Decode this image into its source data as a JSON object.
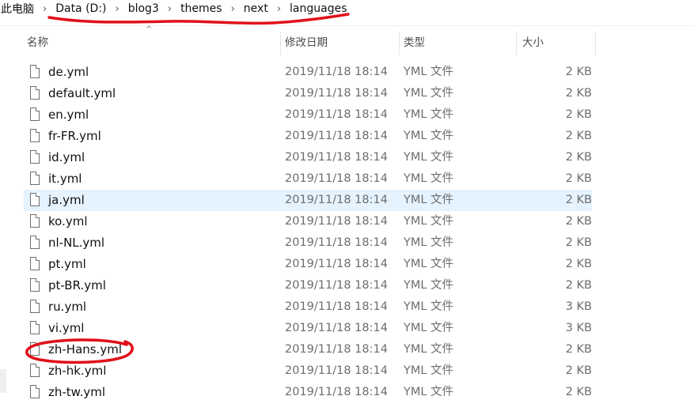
{
  "breadcrumb": {
    "items": [
      "此电脑",
      "Data (D:)",
      "blog3",
      "themes",
      "next",
      "languages"
    ],
    "separator": "›"
  },
  "columns": {
    "name": "名称",
    "date": "修改日期",
    "type": "类型",
    "size": "大小"
  },
  "files": [
    {
      "name": "de.yml",
      "date": "2019/11/18 18:14",
      "type": "YML 文件",
      "size": "2 KB"
    },
    {
      "name": "default.yml",
      "date": "2019/11/18 18:14",
      "type": "YML 文件",
      "size": "2 KB"
    },
    {
      "name": "en.yml",
      "date": "2019/11/18 18:14",
      "type": "YML 文件",
      "size": "2 KB"
    },
    {
      "name": "fr-FR.yml",
      "date": "2019/11/18 18:14",
      "type": "YML 文件",
      "size": "2 KB"
    },
    {
      "name": "id.yml",
      "date": "2019/11/18 18:14",
      "type": "YML 文件",
      "size": "2 KB"
    },
    {
      "name": "it.yml",
      "date": "2019/11/18 18:14",
      "type": "YML 文件",
      "size": "2 KB"
    },
    {
      "name": "ja.yml",
      "date": "2019/11/18 18:14",
      "type": "YML 文件",
      "size": "2 KB"
    },
    {
      "name": "ko.yml",
      "date": "2019/11/18 18:14",
      "type": "YML 文件",
      "size": "2 KB"
    },
    {
      "name": "nl-NL.yml",
      "date": "2019/11/18 18:14",
      "type": "YML 文件",
      "size": "2 KB"
    },
    {
      "name": "pt.yml",
      "date": "2019/11/18 18:14",
      "type": "YML 文件",
      "size": "2 KB"
    },
    {
      "name": "pt-BR.yml",
      "date": "2019/11/18 18:14",
      "type": "YML 文件",
      "size": "2 KB"
    },
    {
      "name": "ru.yml",
      "date": "2019/11/18 18:14",
      "type": "YML 文件",
      "size": "3 KB"
    },
    {
      "name": "vi.yml",
      "date": "2019/11/18 18:14",
      "type": "YML 文件",
      "size": "3 KB"
    },
    {
      "name": "zh-Hans.yml",
      "date": "2019/11/18 18:14",
      "type": "YML 文件",
      "size": "2 KB"
    },
    {
      "name": "zh-hk.yml",
      "date": "2019/11/18 18:14",
      "type": "YML 文件",
      "size": "2 KB"
    },
    {
      "name": "zh-tw.yml",
      "date": "2019/11/18 18:14",
      "type": "YML 文件",
      "size": "2 KB"
    }
  ],
  "highlighted_row": 6,
  "colors": {
    "selection": "#e5f3ff",
    "annotation": "#e0101a"
  },
  "icons": {
    "file": "file-icon",
    "sort": "sort-up-icon"
  }
}
